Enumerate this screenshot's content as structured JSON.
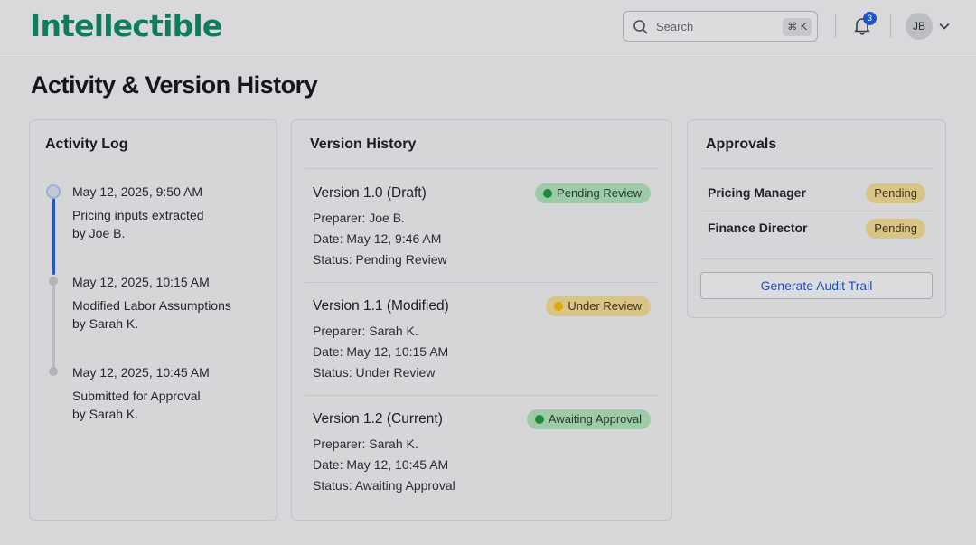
{
  "app": {
    "name": "Intellectible"
  },
  "header": {
    "search_placeholder": "Search",
    "search_shortcut": "⌘ K",
    "notification_count": "3",
    "user_initials": "JB"
  },
  "page": {
    "title": "Activity & Version History"
  },
  "activity_log": {
    "title": "Activity Log",
    "entries": [
      {
        "time": "May 12, 2025, 9:50 AM",
        "line1": "Pricing inputs extracted",
        "line2": "by Joe B."
      },
      {
        "time": "May 12, 2025, 10:15 AM",
        "line1": "Modified Labor Assumptions",
        "line2": "by Sarah K."
      },
      {
        "time": "May 12, 2025, 10:45 AM",
        "line1": "Submitted for Approval",
        "line2": "by Sarah K."
      }
    ]
  },
  "version_history": {
    "title": "Version History",
    "versions": [
      {
        "title": "Version 1.0 (Draft)",
        "preparer": "Preparer: Joe B.",
        "date": "Date: May 12, 9:46 AM",
        "status": "Status: Pending Review",
        "badge": "Pending Review",
        "badge_color": "green"
      },
      {
        "title": "Version 1.1 (Modified)",
        "preparer": "Preparer: Sarah K.",
        "date": "Date: May 12, 10:15 AM",
        "status": "Status: Under Review",
        "badge": "Under Review",
        "badge_color": "yellow"
      },
      {
        "title": "Version 1.2 (Current)",
        "preparer": "Preparer: Sarah K.",
        "date": "Date: May 12, 10:45 AM",
        "status": "Status: Awaiting Approval",
        "badge": "Awaiting Approval",
        "badge_color": "green"
      }
    ]
  },
  "approvals": {
    "title": "Approvals",
    "items": [
      {
        "name": "Pricing Manager",
        "status": "Pending"
      },
      {
        "name": "Finance Director",
        "status": "Pending"
      }
    ],
    "button_label": "Generate Audit Trail"
  },
  "colors": {
    "brand": "#0f7c5f",
    "link": "#1f4fb1",
    "timeline_active": "#2456c8",
    "status_green": "#1b8a3a",
    "status_yellow": "#d9a90e"
  }
}
